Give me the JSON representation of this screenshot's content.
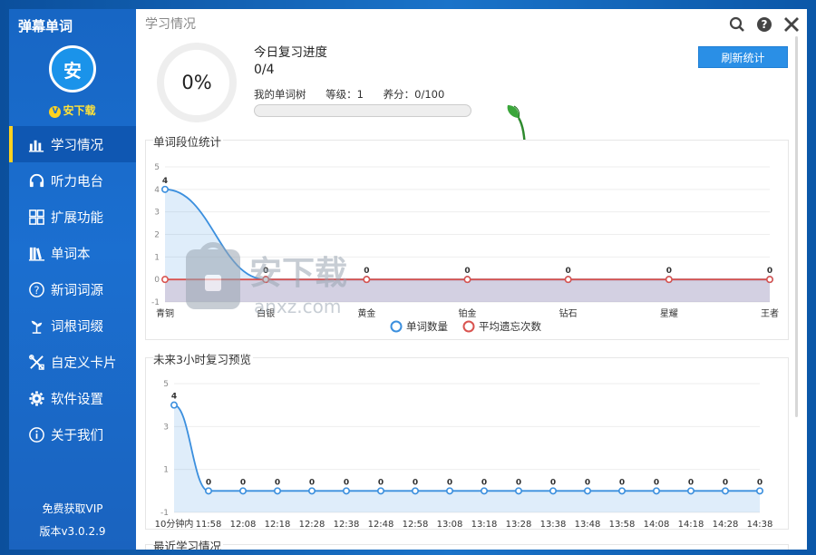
{
  "app": {
    "title": "弹幕单词"
  },
  "user": {
    "avatar_text": "安",
    "name": "安下载",
    "vip_badge": "V"
  },
  "nav": {
    "items": [
      {
        "label": "学习情况",
        "icon": "bar-chart-icon"
      },
      {
        "label": "听力电台",
        "icon": "headphones-icon"
      },
      {
        "label": "扩展功能",
        "icon": "grid-icon"
      },
      {
        "label": "单词本",
        "icon": "books-icon"
      },
      {
        "label": "新词词源",
        "icon": "question-circle-icon"
      },
      {
        "label": "词根词缀",
        "icon": "sprout-icon"
      },
      {
        "label": "自定义卡片",
        "icon": "tools-icon"
      },
      {
        "label": "软件设置",
        "icon": "gear-icon"
      },
      {
        "label": "关于我们",
        "icon": "info-icon"
      }
    ],
    "active_index": 0
  },
  "footer": {
    "vip_text": "免费获取VIP",
    "version": "版本v3.0.2.9"
  },
  "content": {
    "page_title": "学习情况",
    "progress_percent_text": "0%",
    "progress_fraction": 0,
    "today_label": "今日复习进度",
    "today_count": "0/4",
    "tree_label": "我的单词树",
    "tree_level": "等级：1",
    "tree_nutrient": "养分：0/100",
    "tree_fraction": 0,
    "refresh_button": "刷新统计",
    "next_section_title": "最近学习情况"
  },
  "colors": {
    "accent": "#2a8fe6",
    "sidebar": "#1b6fd0",
    "series_blue": "#3b8fde",
    "series_red": "#d9534f"
  },
  "watermark": {
    "text": "安下载",
    "subtext": "anxz.com"
  },
  "chart_data": [
    {
      "type": "line",
      "title": "单词段位统计",
      "categories": [
        "青铜",
        "白银",
        "黄金",
        "铂金",
        "钻石",
        "星耀",
        "王者"
      ],
      "series": [
        {
          "name": "单词数量",
          "values": [
            4,
            0,
            0,
            0,
            0,
            0,
            0
          ],
          "labels": [
            "4",
            "0",
            "0",
            "0",
            "0",
            "0",
            "0"
          ]
        },
        {
          "name": "平均遗忘次数",
          "values": [
            0,
            0,
            0,
            0,
            0,
            0,
            0
          ]
        }
      ],
      "ylim": [
        -1,
        5
      ],
      "yticks": [
        "5",
        "4",
        "3",
        "2",
        "1",
        "0",
        "-1"
      ],
      "legend": "bottom",
      "grid": true
    },
    {
      "type": "line",
      "title": "未来3小时复习预览",
      "categories": [
        "10分钟内",
        "11:58",
        "12:08",
        "12:18",
        "12:28",
        "12:38",
        "12:48",
        "12:58",
        "13:08",
        "13:18",
        "13:28",
        "13:38",
        "13:48",
        "13:58",
        "14:08",
        "14:18",
        "14:28",
        "14:38"
      ],
      "series": [
        {
          "name": "",
          "values": [
            4,
            0,
            0,
            0,
            0,
            0,
            0,
            0,
            0,
            0,
            0,
            0,
            0,
            0,
            0,
            0,
            0,
            0
          ],
          "labels": [
            "4",
            "0",
            "0",
            "0",
            "0",
            "0",
            "0",
            "0",
            "0",
            "0",
            "0",
            "0",
            "0",
            "0",
            "0",
            "0",
            "0",
            "0"
          ]
        }
      ],
      "ylim": [
        -1,
        5
      ],
      "yticks": [
        "5",
        "3",
        "1",
        "-1"
      ],
      "grid": true
    }
  ]
}
